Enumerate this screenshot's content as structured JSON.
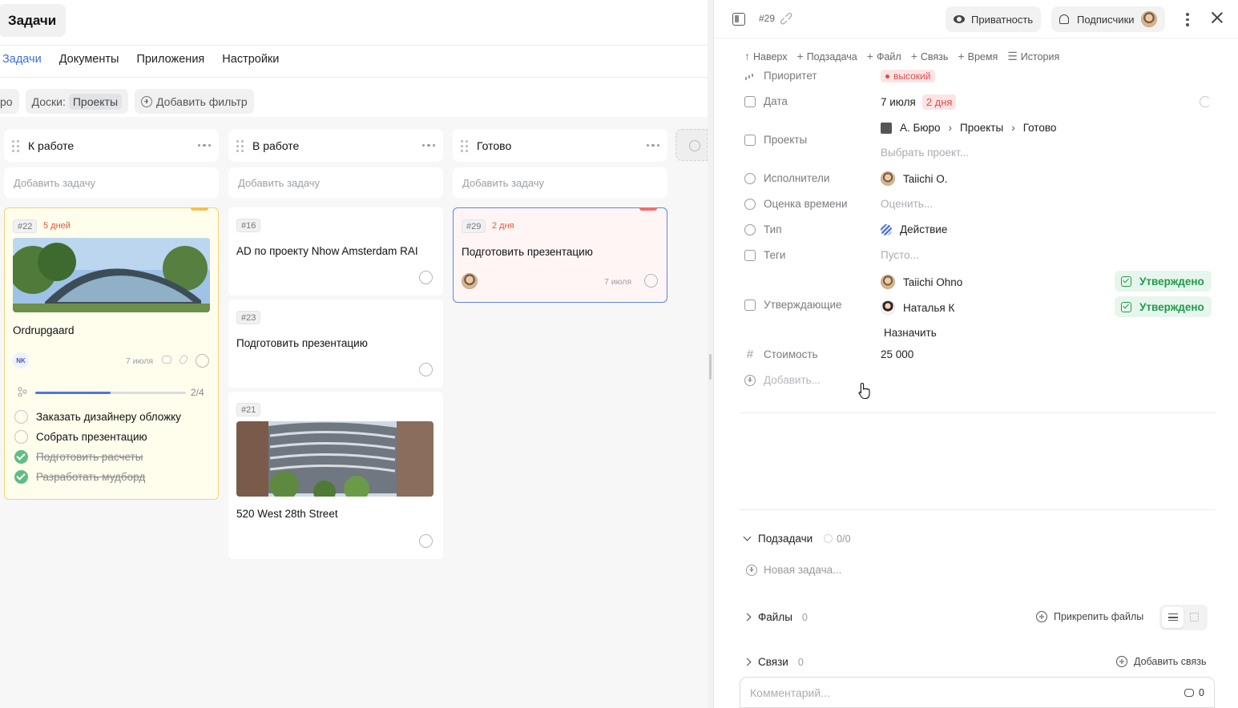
{
  "board": {
    "title": "Задачи",
    "nav": [
      {
        "label": "Задачи",
        "active": true
      },
      {
        "label": "Документы",
        "active": false
      },
      {
        "label": "Приложения",
        "active": false
      },
      {
        "label": "Настройки",
        "active": false
      }
    ],
    "filters": {
      "cut_chip": "ро",
      "boards_label": "Доски:",
      "boards_value": "Проекты",
      "add_filter": "Добавить фильтр"
    },
    "columns": [
      {
        "title": "К работе",
        "add_task": "Добавить задачу"
      },
      {
        "title": "В работе",
        "add_task": "Добавить задачу"
      },
      {
        "title": "Готово",
        "add_task": "Добавить задачу"
      }
    ],
    "cards": {
      "c22": {
        "num": "#22",
        "days": "5 дней",
        "title": "Ordrupgaard",
        "assignee": "NK",
        "date": "7 июля",
        "progress": {
          "done": 2,
          "total": 4,
          "label": "2/4"
        },
        "checklist": [
          {
            "text": "Заказать дизайнеру обложку",
            "done": false
          },
          {
            "text": "Собрать презентацию",
            "done": false
          },
          {
            "text": "Подготовить расчеты",
            "done": true
          },
          {
            "text": "Разработать мудборд",
            "done": true
          }
        ]
      },
      "c16": {
        "num": "#16",
        "title": "AD по проекту Nhow Amsterdam RAI"
      },
      "c23": {
        "num": "#23",
        "title": "Подготовить презентацию"
      },
      "c21": {
        "num": "#21",
        "title": "520 West 28th Street"
      },
      "c29": {
        "num": "#29",
        "days": "2 дня",
        "title": "Подготовить презентацию",
        "date": "7 июля"
      }
    }
  },
  "panel": {
    "task_id": "#29",
    "privacy": "Приватность",
    "subscribers": "Подписчики",
    "actions": [
      "Наверх",
      "Подзадача",
      "Файл",
      "Связь",
      "Время",
      "История"
    ],
    "props": {
      "priority_label": "Приоритет",
      "priority_value": "высокий",
      "date_label": "Дата",
      "date_value": "7 июля",
      "date_badge": "2 дня",
      "projects_label": "Проекты",
      "project_path": [
        "А. Бюро",
        "Проекты",
        "Готово"
      ],
      "project_placeholder": "Выбрать проект...",
      "assignees_label": "Исполнители",
      "assignee": "Taiichi O.",
      "estimate_label": "Оценка времени",
      "estimate_placeholder": "Оценить...",
      "type_label": "Тип",
      "type_value": "Действие",
      "tags_label": "Теги",
      "tags_placeholder": "Пусто...",
      "approvers_label": "Утверждающие",
      "approvers": [
        {
          "name": "Taiichi Ohno",
          "status": "Утверждено"
        },
        {
          "name": "Наталья К",
          "status": "Утверждено"
        }
      ],
      "assign": "Назначить",
      "cost_label": "Стоимость",
      "cost_value": "25 000",
      "add_field": "Добавить..."
    },
    "subtasks": {
      "label": "Подзадачи",
      "count": "0/0",
      "new": "Новая задача..."
    },
    "files": {
      "label": "Файлы",
      "count": "0",
      "attach": "Прикрепить файлы"
    },
    "links": {
      "label": "Связи",
      "count": "0",
      "add": "Добавить связь"
    },
    "comment": {
      "placeholder": "Комментарий...",
      "count": "0"
    }
  },
  "colors": {
    "accent": "#3b6fd6",
    "danger": "#e24d4d",
    "success": "#1f9a4d",
    "card_yellow": "#fffdec"
  }
}
